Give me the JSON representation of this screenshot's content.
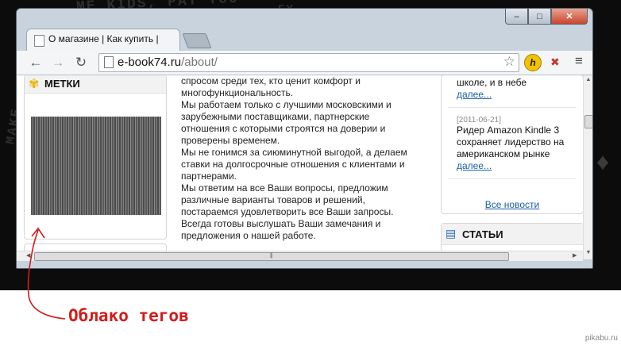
{
  "desktop": {
    "bg_text_1": "ME KIDS, PAT TOO",
    "bg_text_2": "FY",
    "bg_text_3": "MAKE",
    "bg_text_4": "♦"
  },
  "browser": {
    "tab_title": "О магазине | Как купить |",
    "url_host": "e-book74.ru",
    "url_path": "/about/",
    "back_icon": "←",
    "forward_icon": "→",
    "reload_icon": "↻",
    "star_icon": "☆",
    "ext_h_label": "h",
    "ext_x_label": "✖",
    "menu_icon": "≡",
    "min_icon": "–",
    "max_icon": "□",
    "close_icon": "✕"
  },
  "left_sidebar": {
    "title": "МЕТКИ",
    "icon": "✾"
  },
  "main_text": [
    "спросом среди тех, кто ценит комфорт и",
    "многофункциональность.",
    "Мы работаем только с лучшими московскими и",
    "зарубежными поставщиками, партнерские",
    "отношения с которыми строятся на доверии и",
    "проверены временем.",
    "Мы не гонимся за сиюминутной выгодой,  а делаем",
    "ставки на долгосрочные отношения с клиентами и",
    "партнерами.",
    "Мы ответим на все Ваши вопросы, предложим",
    "различные варианты товаров и решений,",
    "постараемся удовлетворить все Ваши запросы.",
    "Всегда готовы выслушать Ваши замечания и",
    "предложения о нашей работе."
  ],
  "news": {
    "item1_line": "школе, и в небе",
    "item1_more": "далее...",
    "item2_date": "[2011-06-21]",
    "item2_line1": "Ридер Amazon Kindle 3",
    "item2_line2": "сохраняет лидерство на",
    "item2_line3": "американском рынке",
    "item2_more": "далее...",
    "all_news": "Все новости"
  },
  "articles": {
    "title": "СТАТЬИ",
    "icon": "▤"
  },
  "annotation": {
    "callout": "Облако тегов",
    "color": "#d21c1c"
  },
  "watermark": "pikabu.ru"
}
